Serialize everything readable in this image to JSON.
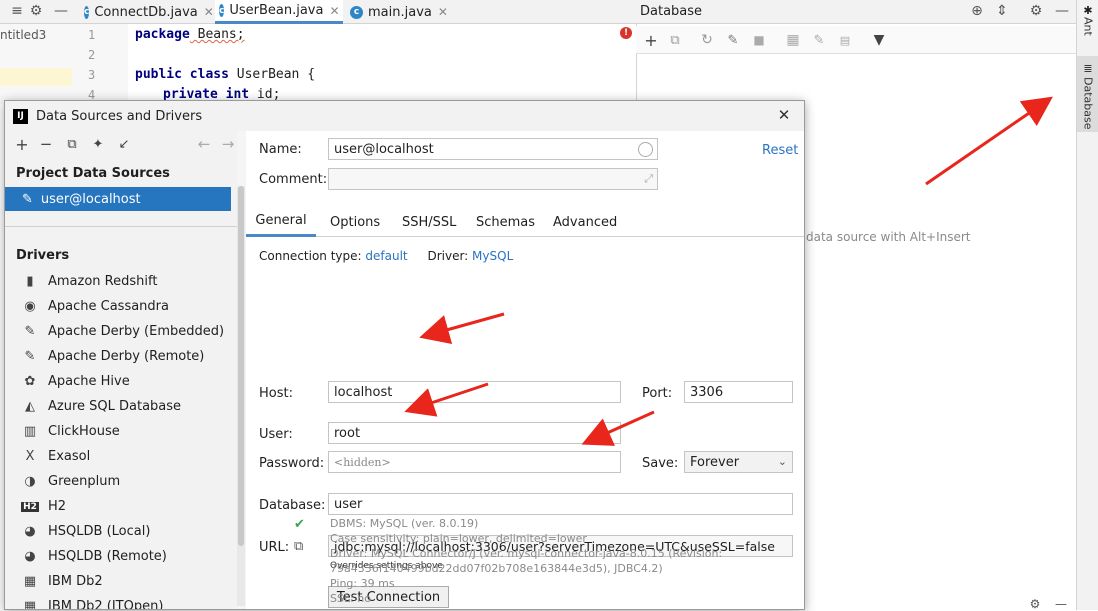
{
  "top_tabs": [
    {
      "label": "ConnectDb.java"
    },
    {
      "label": "UserBean.java",
      "active": true
    },
    {
      "label": "main.java"
    }
  ],
  "left_project_label": "ntitled3",
  "editor": {
    "line_numbers": [
      "1",
      "2",
      "3",
      "4"
    ],
    "line1_kw": "package",
    "line1_rest": " Beans;",
    "line3_kw1": "public",
    "line3_kw2": "class",
    "line3_rest": " UserBean {",
    "line4_kw1": "private",
    "line4_kw2": "int",
    "line4_rest": " id;"
  },
  "db_panel": {
    "title": "Database",
    "hint": "data source with Alt+Insert"
  },
  "side_strip": {
    "ant": "Ant",
    "database": "Database"
  },
  "dialog": {
    "title": "Data Sources and Drivers",
    "project_sources_header": "Project Data Sources",
    "selected_source": "user@localhost",
    "drivers_header": "Drivers",
    "drivers": [
      {
        "name": "Amazon Redshift",
        "icon": "▮"
      },
      {
        "name": "Apache Cassandra",
        "icon": "◉"
      },
      {
        "name": "Apache Derby (Embedded)",
        "icon": "✎"
      },
      {
        "name": "Apache Derby (Remote)",
        "icon": "✎"
      },
      {
        "name": "Apache Hive",
        "icon": "✿"
      },
      {
        "name": "Azure SQL Database",
        "icon": "◭"
      },
      {
        "name": "ClickHouse",
        "icon": "▥"
      },
      {
        "name": "Exasol",
        "icon": "X"
      },
      {
        "name": "Greenplum",
        "icon": "◑"
      },
      {
        "name": "H2",
        "icon": "H2"
      },
      {
        "name": "HSQLDB (Local)",
        "icon": "◕"
      },
      {
        "name": "HSQLDB (Remote)",
        "icon": "◕"
      },
      {
        "name": "IBM Db2",
        "icon": "▦"
      },
      {
        "name": "IBM Db2 (JTOpen)",
        "icon": "▦"
      }
    ],
    "name_label": "Name:",
    "name_value": "user@localhost",
    "reset_label": "Reset",
    "comment_label": "Comment:",
    "tabs": [
      "General",
      "Options",
      "SSH/SSL",
      "Schemas",
      "Advanced"
    ],
    "conn_type_label": "Connection type:",
    "conn_type_value": "default",
    "driver_label": "Driver:",
    "driver_value": "MySQL",
    "host_label": "Host:",
    "host_value": "localhost",
    "port_label": "Port:",
    "port_value": "3306",
    "user_label": "User:",
    "user_value": "root",
    "password_label": "Password:",
    "password_value": "<hidden>",
    "save_label": "Save:",
    "save_value": "Forever",
    "database_label": "Database:",
    "database_value": "user",
    "url_label": "URL:",
    "url_value": "jdbc:mysql://localhost:3306/user?serverTimezone=UTC&useSSL=false",
    "url_note": "Overrides settings above",
    "test_button": "Test Connection",
    "result_lines": [
      "DBMS: MySQL (ver. 8.0.19)",
      "Case sensitivity: plain=lower, delimited=lower",
      "Driver: MySQL Connector/J (ver. mysql-connector-java-8.0.15 (Revision:",
      "79a4336f140499bd22dd07f02b708e163844e3d5), JDBC4.2)",
      "Ping: 39 ms",
      "SSL: no"
    ]
  },
  "colors": {
    "accent": "#2a73c4",
    "selection": "#2675bf",
    "arrow": "#e8261c"
  }
}
